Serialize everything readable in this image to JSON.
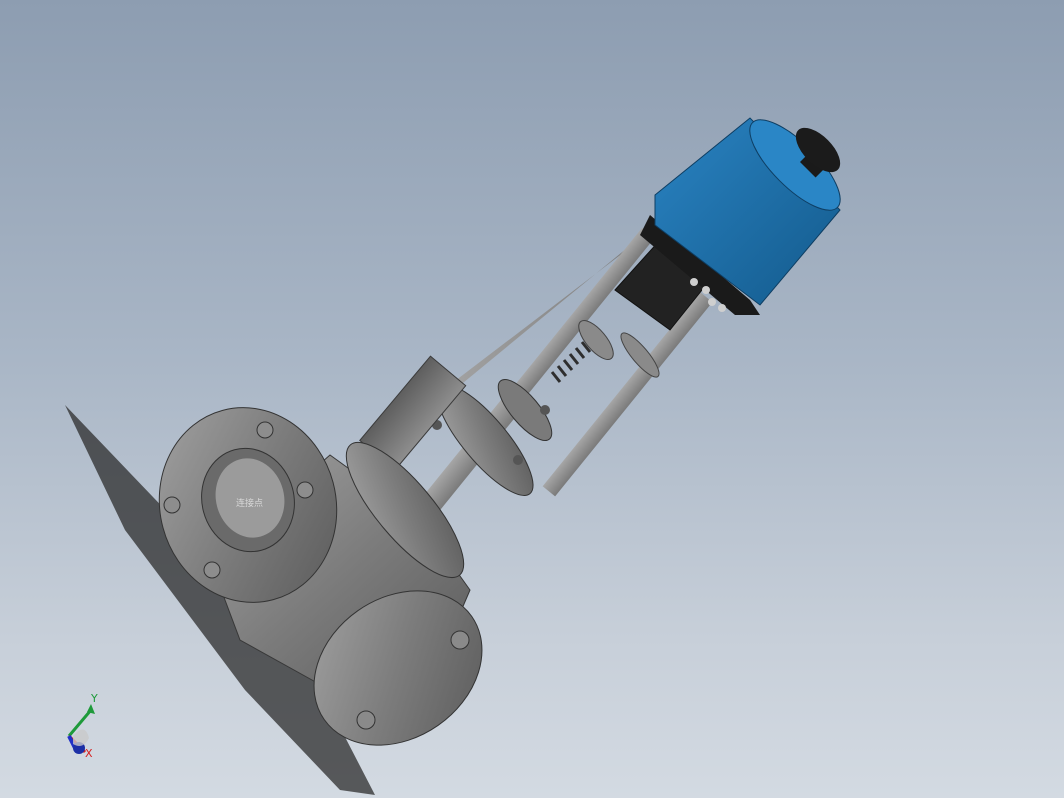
{
  "viewport": {
    "model": "control-valve-assembly",
    "background": [
      "#8d9db1",
      "#d3dae2"
    ]
  },
  "model": {
    "port_label": "连接点",
    "colors": {
      "body": "#6e6e6e",
      "body_light": "#9a9a9a",
      "actuator_cover": "#1e6fa8",
      "actuator_base": "#262626",
      "handwheel": "#1a1a1a",
      "spring": "#3a3a3a",
      "shadow": "#2a2a2a"
    }
  },
  "triad": {
    "y_label": "Y",
    "x_label": "X",
    "z_label": "",
    "colors": {
      "x": "#d62020",
      "y": "#1e9a3a",
      "z": "#2030c8"
    }
  }
}
